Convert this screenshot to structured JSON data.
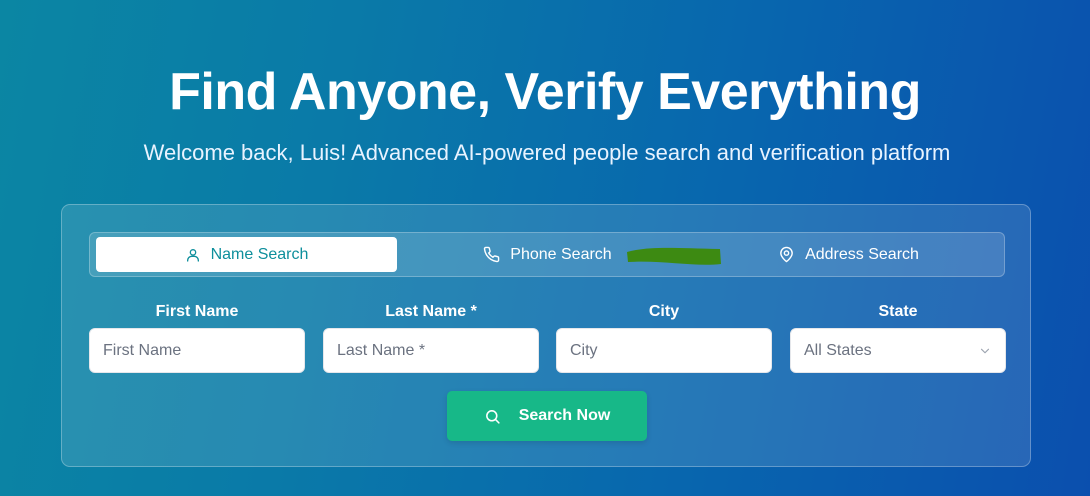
{
  "hero": {
    "title": "Find Anyone, Verify Everything",
    "subtitle": "Welcome back, Luis! Advanced AI-powered people search and verification platform"
  },
  "tabs": [
    {
      "label": "Name Search",
      "icon": "user-icon",
      "active": true
    },
    {
      "label": "Phone Search",
      "icon": "phone-icon",
      "active": false
    },
    {
      "label": "Address Search",
      "icon": "map-pin-icon",
      "active": false
    }
  ],
  "form": {
    "first_name": {
      "label": "First Name",
      "placeholder": "First Name",
      "value": ""
    },
    "last_name": {
      "label": "Last Name *",
      "placeholder": "Last Name *",
      "value": ""
    },
    "city": {
      "label": "City",
      "placeholder": "City",
      "value": ""
    },
    "state": {
      "label": "State",
      "selected": "All States"
    }
  },
  "search_button": {
    "label": "Search Now",
    "icon": "search-icon"
  },
  "colors": {
    "background_start": "#0b86a3",
    "background_end": "#0b4fae",
    "active_tab_text": "#0e8f9c",
    "button": "#17b888",
    "scribble": "#3d8a12"
  }
}
